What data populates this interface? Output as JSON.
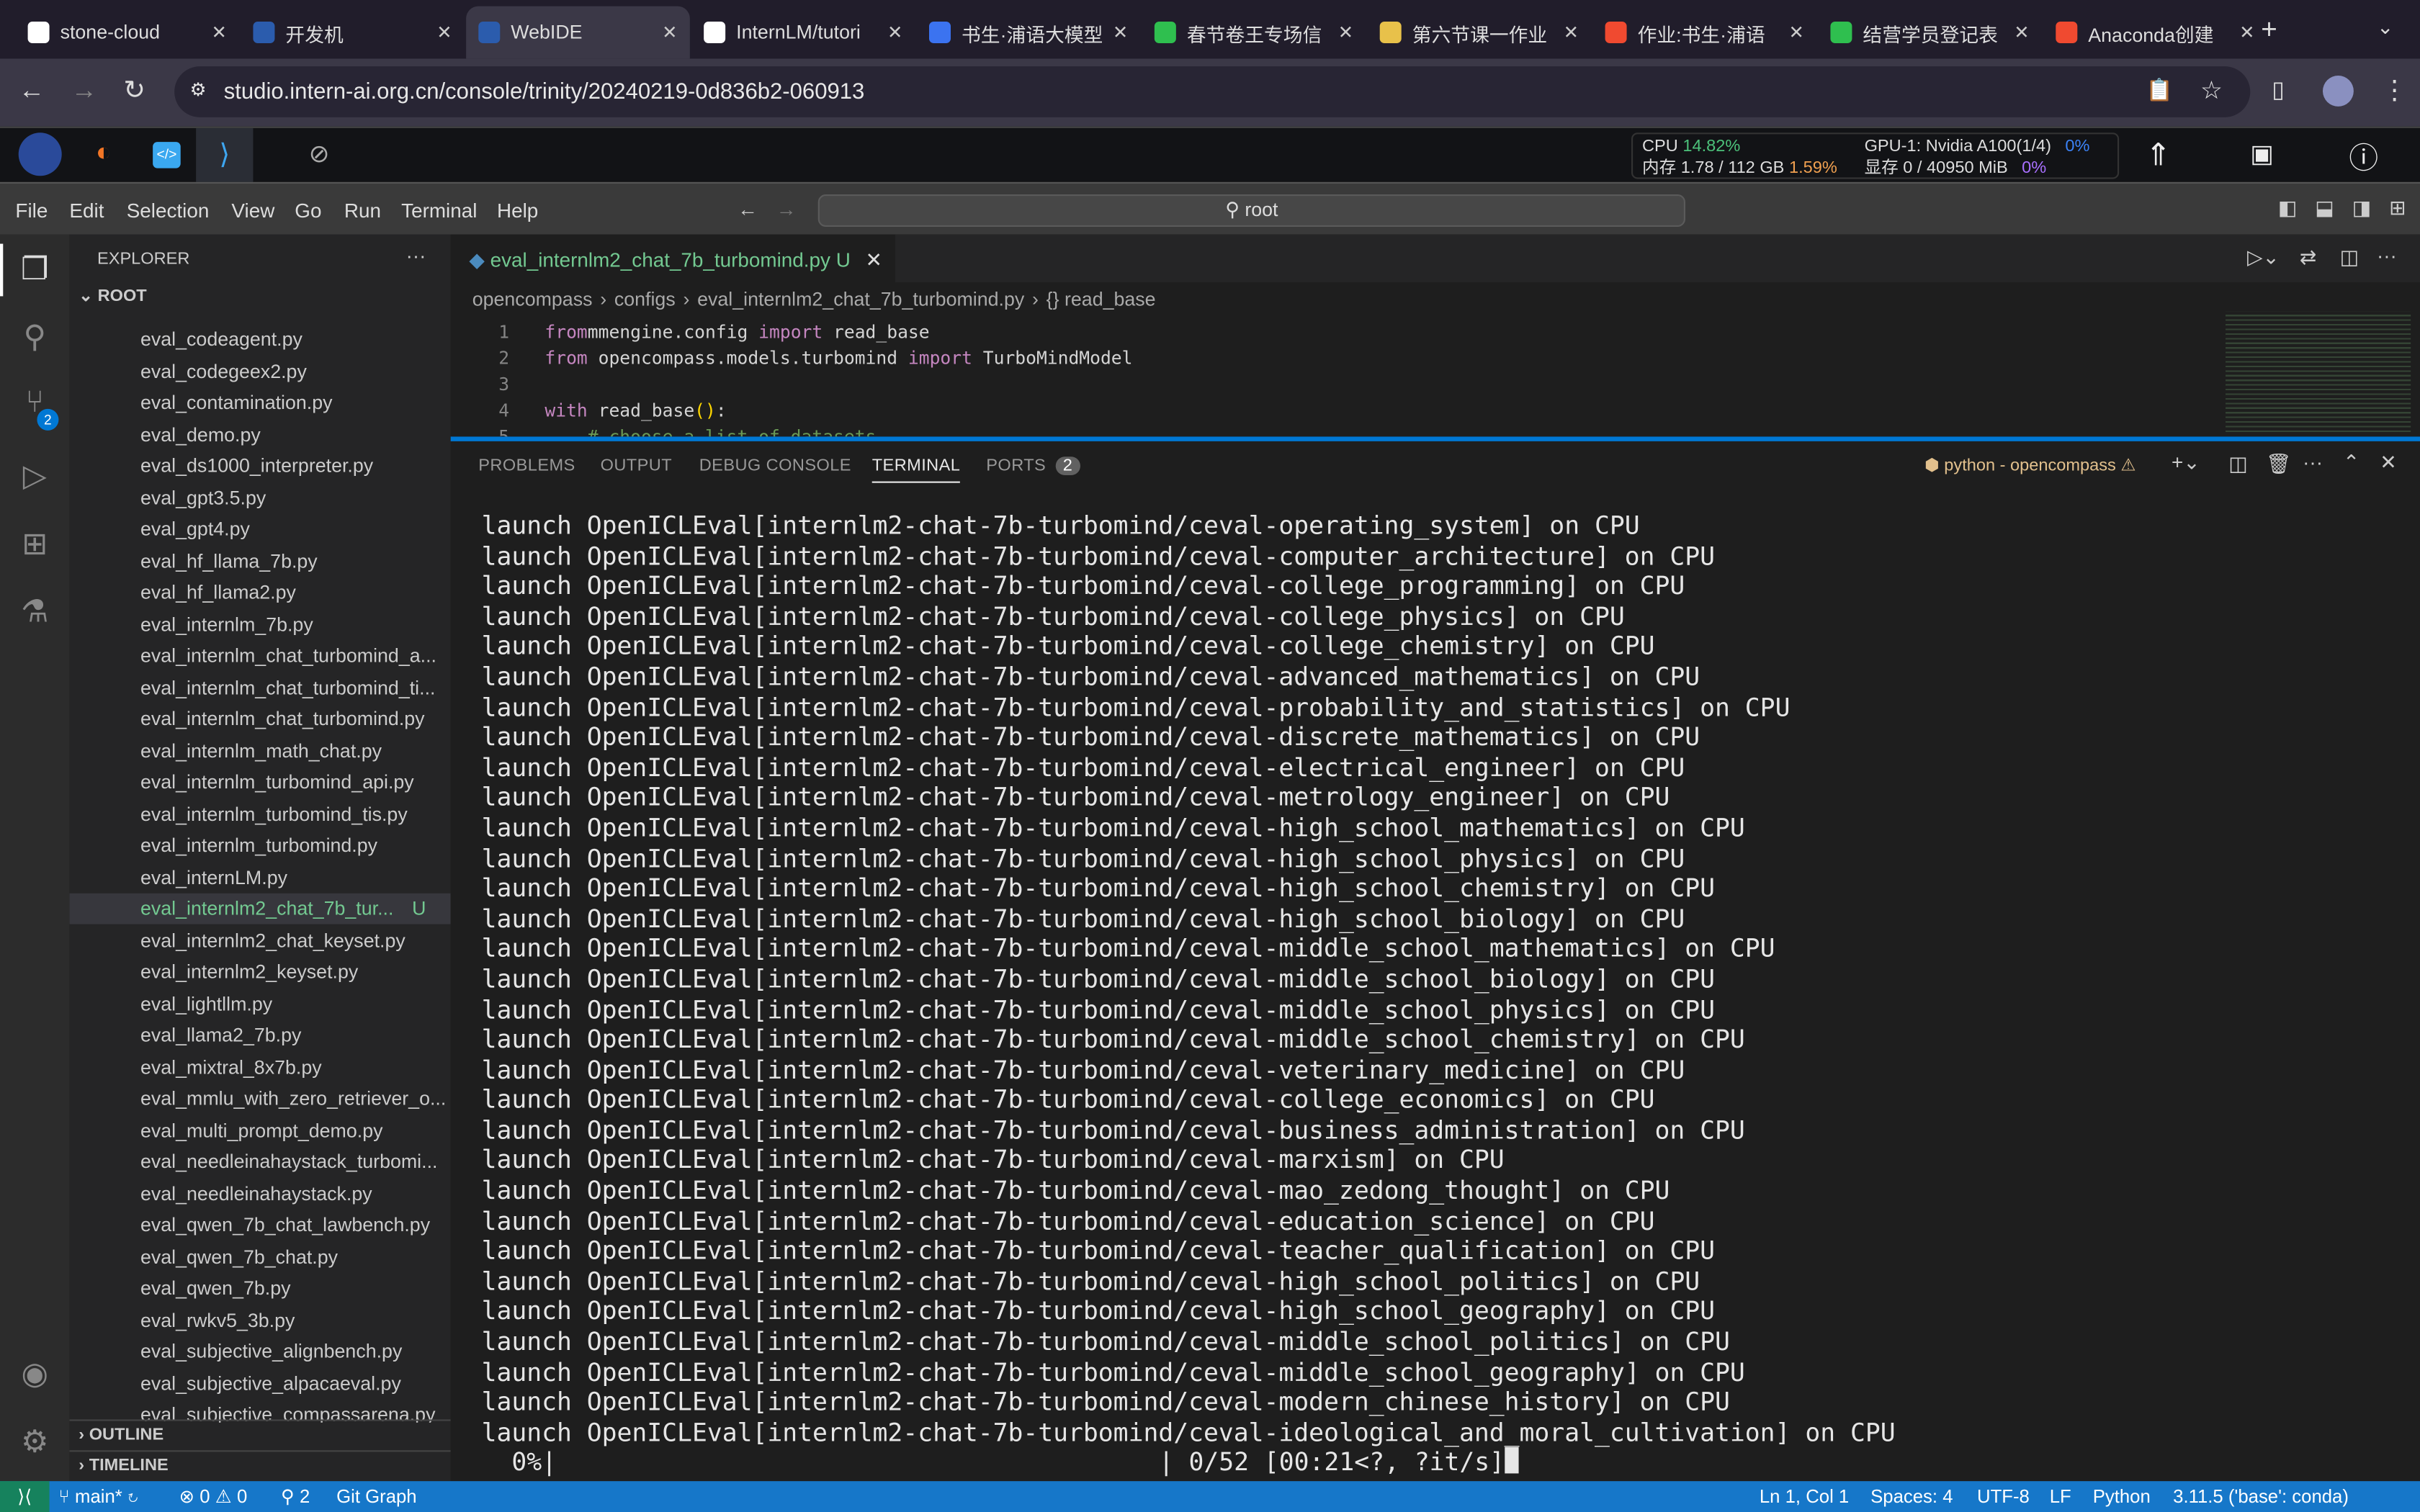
{
  "browser": {
    "tabs": [
      {
        "title": "stone-cloud",
        "color": "#ffffff"
      },
      {
        "title": "开发机",
        "color": "#2b5cad"
      },
      {
        "title": "WebIDE",
        "color": "#2b5cad",
        "active": true
      },
      {
        "title": "InternLM/tutori",
        "color": "#ffffff"
      },
      {
        "title": "书生·浦语大模型",
        "color": "#3b73f0"
      },
      {
        "title": "春节卷王专场信",
        "color": "#2fbf4f"
      },
      {
        "title": "第六节课一作业",
        "color": "#e8c14a"
      },
      {
        "title": "作业:书生·浦语",
        "color": "#f04a30"
      },
      {
        "title": "结营学员登记表",
        "color": "#2fbf4f"
      },
      {
        "title": "Anaconda创建",
        "color": "#f04a30"
      }
    ],
    "url": "studio.intern-ai.org.cn/console/trinity/20240219-0d836b2-060913"
  },
  "stats": {
    "cpu_label": "CPU",
    "cpu": "14.82%",
    "mem_label": "内存 1.78 / 112 GB",
    "mem": "1.59%",
    "gpu_label": "GPU-1: Nvidia A100(1/4)",
    "gpu": "0%",
    "vram_label": "显存 0 / 40950 MiB",
    "vram": "0%",
    "colors": {
      "cpu": "#4cc17a",
      "mem": "#f0a050",
      "gpu": "#3b82f6",
      "vram": "#a970ff"
    }
  },
  "menu": [
    "File",
    "Edit",
    "Selection",
    "View",
    "Go",
    "Run",
    "Terminal",
    "Help"
  ],
  "search": "root",
  "explorer": {
    "title": "EXPLORER",
    "root": "ROOT",
    "outline": "OUTLINE",
    "timeline": "TIMELINE",
    "files": [
      "eval_codeagent.py",
      "eval_codegeex2.py",
      "eval_contamination.py",
      "eval_demo.py",
      "eval_ds1000_interpreter.py",
      "eval_gpt3.5.py",
      "eval_gpt4.py",
      "eval_hf_llama_7b.py",
      "eval_hf_llama2.py",
      "eval_internlm_7b.py",
      "eval_internlm_chat_turbomind_a...",
      "eval_internlm_chat_turbomind_ti...",
      "eval_internlm_chat_turbomind.py",
      "eval_internlm_math_chat.py",
      "eval_internlm_turbomind_api.py",
      "eval_internlm_turbomind_tis.py",
      "eval_internlm_turbomind.py",
      "eval_internLM.py",
      "eval_internlm2_chat_7b_tur...",
      "eval_internlm2_chat_keyset.py",
      "eval_internlm2_keyset.py",
      "eval_lightllm.py",
      "eval_llama2_7b.py",
      "eval_mixtral_8x7b.py",
      "eval_mmlu_with_zero_retriever_o...",
      "eval_multi_prompt_demo.py",
      "eval_needleinahaystack_turbomi...",
      "eval_needleinahaystack.py",
      "eval_qwen_7b_chat_lawbench.py",
      "eval_qwen_7b_chat.py",
      "eval_qwen_7b.py",
      "eval_rwkv5_3b.py",
      "eval_subjective_alignbench.py",
      "eval_subjective_alpacaeval.py",
      "eval_subjective_compassarena.py"
    ],
    "selected_index": 18,
    "selected_badge": "U",
    "scm_badge": "2"
  },
  "editor": {
    "tab": "eval_internlm2_chat_7b_turbomind.py",
    "tab_badge": "U",
    "breadcrumb": [
      "opencompass",
      "configs",
      "eval_internlm2_chat_7b_turbomind.py",
      "{} read_base"
    ],
    "lines": [
      {
        "n": "1",
        "tokens": [
          [
            "kw",
            "from"
          ],
          [
            "",
            "mmengine.config "
          ],
          [
            "kw",
            "import"
          ],
          [
            "",
            " read_base"
          ]
        ]
      },
      {
        "n": "2",
        "tokens": [
          [
            "kw",
            "from"
          ],
          [
            "",
            " opencompass.models.turbomind "
          ],
          [
            "kw",
            "import"
          ],
          [
            "",
            " TurboMindModel"
          ]
        ]
      },
      {
        "n": "3",
        "tokens": []
      },
      {
        "n": "4",
        "tokens": [
          [
            "kw",
            "with"
          ],
          [
            "",
            " read_base"
          ],
          [
            "br",
            "()"
          ],
          [
            "",
            ":"
          ]
        ]
      },
      {
        "n": "5",
        "tokens": [
          [
            "",
            "    "
          ],
          [
            "cm",
            "# choose a list of datasets"
          ]
        ]
      }
    ]
  },
  "panel": {
    "tabs": [
      "PROBLEMS",
      "OUTPUT",
      "DEBUG CONSOLE",
      "TERMINAL",
      "PORTS"
    ],
    "active": "TERMINAL",
    "ports_badge": "2",
    "terminal_name": "python - opencompass",
    "lines": [
      "launch OpenICLEval[internlm2-chat-7b-turbomind/ceval-operating_system] on CPU",
      "launch OpenICLEval[internlm2-chat-7b-turbomind/ceval-computer_architecture] on CPU",
      "launch OpenICLEval[internlm2-chat-7b-turbomind/ceval-college_programming] on CPU",
      "launch OpenICLEval[internlm2-chat-7b-turbomind/ceval-college_physics] on CPU",
      "launch OpenICLEval[internlm2-chat-7b-turbomind/ceval-college_chemistry] on CPU",
      "launch OpenICLEval[internlm2-chat-7b-turbomind/ceval-advanced_mathematics] on CPU",
      "launch OpenICLEval[internlm2-chat-7b-turbomind/ceval-probability_and_statistics] on CPU",
      "launch OpenICLEval[internlm2-chat-7b-turbomind/ceval-discrete_mathematics] on CPU",
      "launch OpenICLEval[internlm2-chat-7b-turbomind/ceval-electrical_engineer] on CPU",
      "launch OpenICLEval[internlm2-chat-7b-turbomind/ceval-metrology_engineer] on CPU",
      "launch OpenICLEval[internlm2-chat-7b-turbomind/ceval-high_school_mathematics] on CPU",
      "launch OpenICLEval[internlm2-chat-7b-turbomind/ceval-high_school_physics] on CPU",
      "launch OpenICLEval[internlm2-chat-7b-turbomind/ceval-high_school_chemistry] on CPU",
      "launch OpenICLEval[internlm2-chat-7b-turbomind/ceval-high_school_biology] on CPU",
      "launch OpenICLEval[internlm2-chat-7b-turbomind/ceval-middle_school_mathematics] on CPU",
      "launch OpenICLEval[internlm2-chat-7b-turbomind/ceval-middle_school_biology] on CPU",
      "launch OpenICLEval[internlm2-chat-7b-turbomind/ceval-middle_school_physics] on CPU",
      "launch OpenICLEval[internlm2-chat-7b-turbomind/ceval-middle_school_chemistry] on CPU",
      "launch OpenICLEval[internlm2-chat-7b-turbomind/ceval-veterinary_medicine] on CPU",
      "launch OpenICLEval[internlm2-chat-7b-turbomind/ceval-college_economics] on CPU",
      "launch OpenICLEval[internlm2-chat-7b-turbomind/ceval-business_administration] on CPU",
      "launch OpenICLEval[internlm2-chat-7b-turbomind/ceval-marxism] on CPU",
      "launch OpenICLEval[internlm2-chat-7b-turbomind/ceval-mao_zedong_thought] on CPU",
      "launch OpenICLEval[internlm2-chat-7b-turbomind/ceval-education_science] on CPU",
      "launch OpenICLEval[internlm2-chat-7b-turbomind/ceval-teacher_qualification] on CPU",
      "launch OpenICLEval[internlm2-chat-7b-turbomind/ceval-high_school_politics] on CPU",
      "launch OpenICLEval[internlm2-chat-7b-turbomind/ceval-high_school_geography] on CPU",
      "launch OpenICLEval[internlm2-chat-7b-turbomind/ceval-middle_school_politics] on CPU",
      "launch OpenICLEval[internlm2-chat-7b-turbomind/ceval-middle_school_geography] on CPU",
      "launch OpenICLEval[internlm2-chat-7b-turbomind/ceval-modern_chinese_history] on CPU",
      "launch OpenICLEval[internlm2-chat-7b-turbomind/ceval-ideological_and_moral_cultivation] on CPU"
    ],
    "progress_pct": "  0%|",
    "progress_tail": "| 0/52 [00:21<?, ?it/s]"
  },
  "status": {
    "branch": "main*",
    "errors": "0",
    "warnings": "0",
    "ports": "2",
    "git_graph": "Git Graph",
    "position": "Ln 1, Col 1",
    "spaces": "Spaces: 4",
    "encoding": "UTF-8",
    "eol": "LF",
    "language": "Python",
    "interpreter": "3.11.5 ('base': conda)"
  }
}
